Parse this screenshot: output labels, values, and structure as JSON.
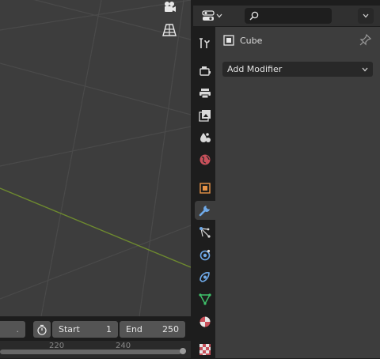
{
  "timeline": {
    "start_label": "Start",
    "start_value": "1",
    "end_label": "End",
    "end_value": "250",
    "ruler_ticks": [
      "220",
      "240"
    ]
  },
  "properties": {
    "search": {
      "placeholder": ""
    },
    "object_name": "Cube",
    "add_modifier_label": "Add Modifier",
    "tabs": [
      {
        "name": "tool-tab",
        "icon": "tool-icon"
      },
      {
        "name": "render-tab",
        "icon": "render-icon"
      },
      {
        "name": "output-tab",
        "icon": "output-icon"
      },
      {
        "name": "view-layer-tab",
        "icon": "view-layer-icon"
      },
      {
        "name": "scene-tab",
        "icon": "scene-icon"
      },
      {
        "name": "world-tab",
        "icon": "world-icon"
      },
      {
        "name": "object-tab",
        "icon": "object-icon"
      },
      {
        "name": "modifier-tab",
        "icon": "wrench-icon",
        "active": true
      },
      {
        "name": "particles-tab",
        "icon": "particles-icon"
      },
      {
        "name": "physics-tab",
        "icon": "physics-icon"
      },
      {
        "name": "constraints-tab",
        "icon": "constraints-icon"
      },
      {
        "name": "object-data-tab",
        "icon": "mesh-data-icon"
      },
      {
        "name": "material-tab",
        "icon": "material-icon"
      },
      {
        "name": "texture-tab",
        "icon": "texture-icon"
      }
    ]
  },
  "colors": {
    "viewport_bg": "#3d3d3d",
    "grid_line": "#4a4a4a",
    "x_axis_line": "#6e8a2f",
    "modifier_accent": "#6fa9e8"
  }
}
